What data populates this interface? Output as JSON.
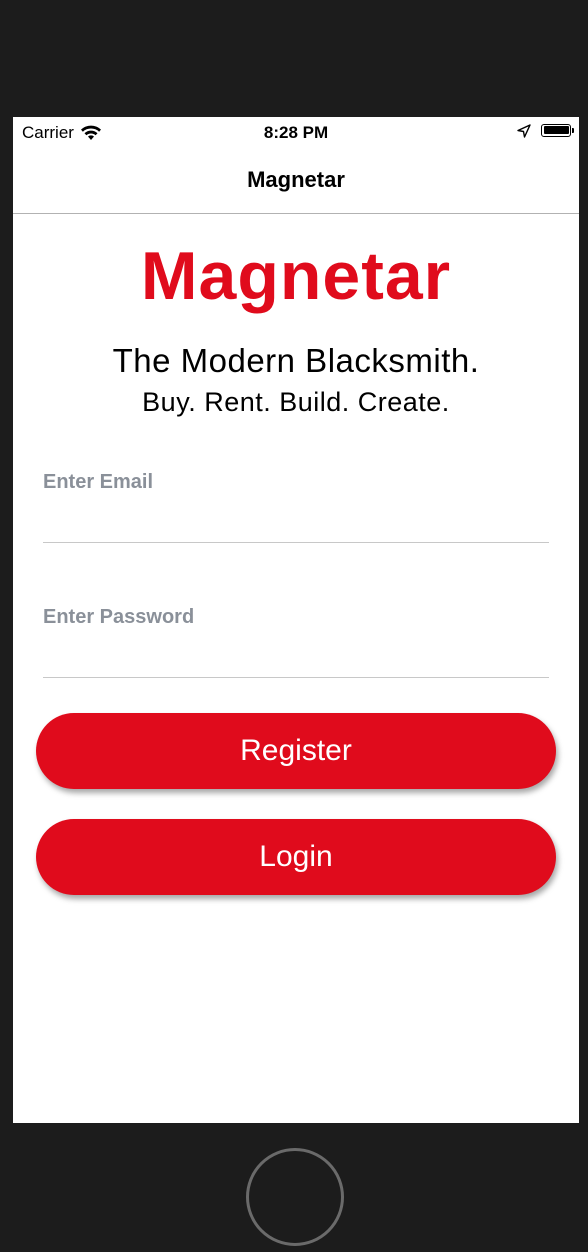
{
  "status_bar": {
    "carrier": "Carrier",
    "time": "8:28 PM"
  },
  "nav": {
    "title": "Magnetar"
  },
  "hero": {
    "logo_text": "Magnetar",
    "tagline": "The Modern Blacksmith.",
    "subtagline": "Buy. Rent. Build. Create."
  },
  "form": {
    "email": {
      "placeholder": "Enter Email",
      "value": ""
    },
    "password": {
      "placeholder": "Enter Password",
      "value": ""
    }
  },
  "buttons": {
    "register_label": "Register",
    "login_label": "Login"
  },
  "colors": {
    "brand_red": "#e00b1c",
    "device_frame": "#1c1c1c"
  },
  "icons": [
    "wifi-icon",
    "location-icon",
    "battery-icon",
    "home-button"
  ]
}
